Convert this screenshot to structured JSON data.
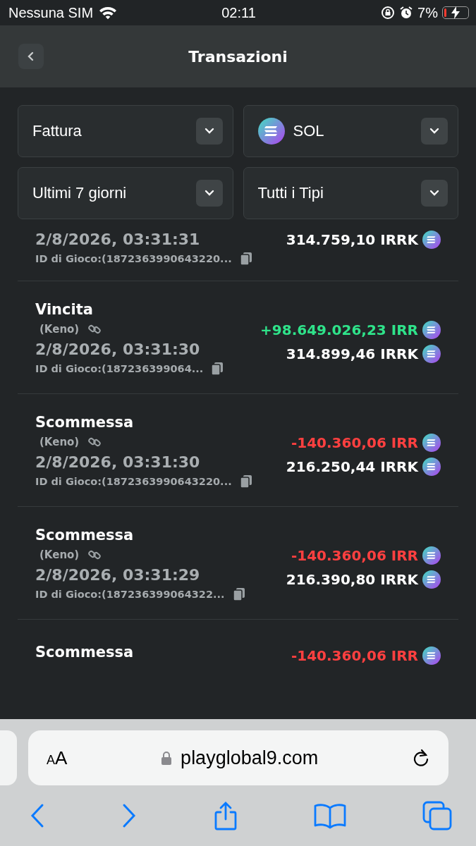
{
  "status_bar": {
    "carrier": "Nessuna SIM",
    "time": "02:11",
    "battery": "7%"
  },
  "header": {
    "title": "Transazioni"
  },
  "filters": [
    {
      "kind": "plain",
      "label": "Fattura"
    },
    {
      "kind": "coin",
      "label": "SOL"
    },
    {
      "kind": "plain",
      "label": "Ultimi 7 giorni"
    },
    {
      "kind": "plain",
      "label": "Tutti i Tipi"
    }
  ],
  "transactions": [
    {
      "date": "2/8/2026, 03:31:31",
      "balance": "314.759,10 IRRK",
      "game_id": "ID di Gioco:(1872363990643220..."
    },
    {
      "type": "Vincita",
      "game": "(Keno)",
      "color": "#2fe38a",
      "amount": "+98.649.026,23 IRR",
      "date": "2/8/2026, 03:31:30",
      "balance": "314.899,46 IRRK",
      "game_id": "ID di Gioco:(187236399064..."
    },
    {
      "type": "Scommessa",
      "game": "(Keno)",
      "color": "#ff4040",
      "amount": "-140.360,06 IRR",
      "date": "2/8/2026, 03:31:30",
      "balance": "216.250,44 IRRK",
      "game_id": "ID di Gioco:(1872363990643220..."
    },
    {
      "type": "Scommessa",
      "game": "(Keno)",
      "color": "#ff4040",
      "amount": "-140.360,06 IRR",
      "date": "2/8/2026, 03:31:29",
      "balance": "216.390,80 IRRK",
      "game_id": "ID di Gioco:(187236399064322..."
    },
    {
      "type": "Scommessa",
      "color": "#ff4040",
      "amount": "-140.360,06 IRR"
    }
  ],
  "browser": {
    "text_size_label": "AA",
    "url": "playglobal9.com"
  }
}
